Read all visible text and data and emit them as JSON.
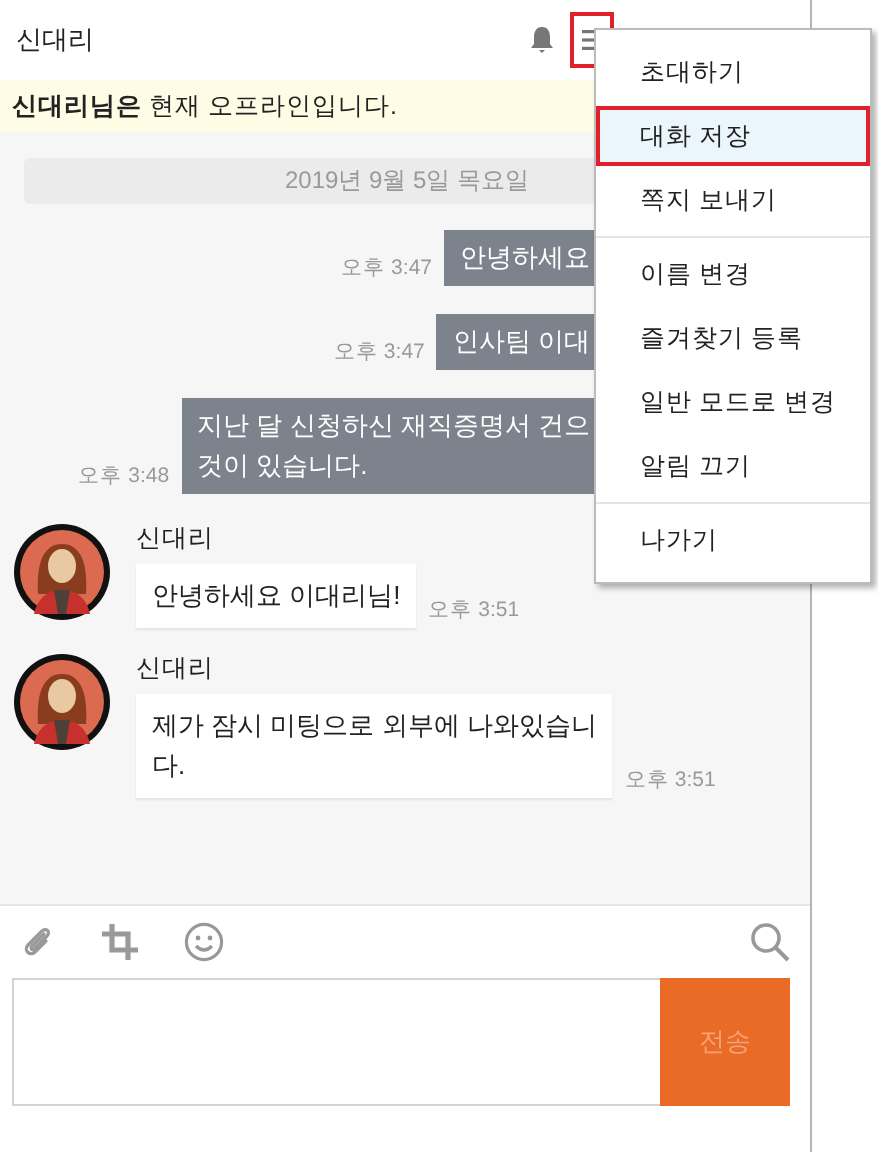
{
  "header": {
    "title": "신대리",
    "menu_button": {
      "highlighted": true
    }
  },
  "notice": {
    "name": "신대리님은",
    "text": " 현재 오프라인입니다."
  },
  "date_divider": "2019년 9월 5일 목요일",
  "messages": [
    {
      "kind": "outgoing",
      "text": "안녕하세요",
      "time": "오후 3:47"
    },
    {
      "kind": "outgoing",
      "text": "인사팀 이대",
      "time": "오후 3:47"
    },
    {
      "kind": "outgoing",
      "text": "지난 달 신청하신 재직증명서 건으\n것이 있습니다.",
      "time": "오후 3:48"
    },
    {
      "kind": "incoming",
      "sender": "신대리",
      "text": "안녕하세요 이대리님!",
      "time": "오후 3:51"
    },
    {
      "kind": "incoming",
      "sender": "신대리",
      "text": "제가 잠시 미팅으로 외부에 나와있습니\n다.",
      "time": "오후 3:51"
    }
  ],
  "composer": {
    "send_label": "전송"
  },
  "menu": {
    "groups": [
      [
        {
          "label": "초대하기",
          "selected": false
        },
        {
          "label": "대화 저장",
          "selected": true
        },
        {
          "label": "쪽지 보내기",
          "selected": false
        }
      ],
      [
        {
          "label": "이름 변경",
          "selected": false
        },
        {
          "label": "즐겨찾기 등록",
          "selected": false
        },
        {
          "label": "일반 모드로 변경",
          "selected": false
        },
        {
          "label": "알림 끄기",
          "selected": false
        }
      ],
      [
        {
          "label": "나가기",
          "selected": false
        }
      ]
    ]
  }
}
